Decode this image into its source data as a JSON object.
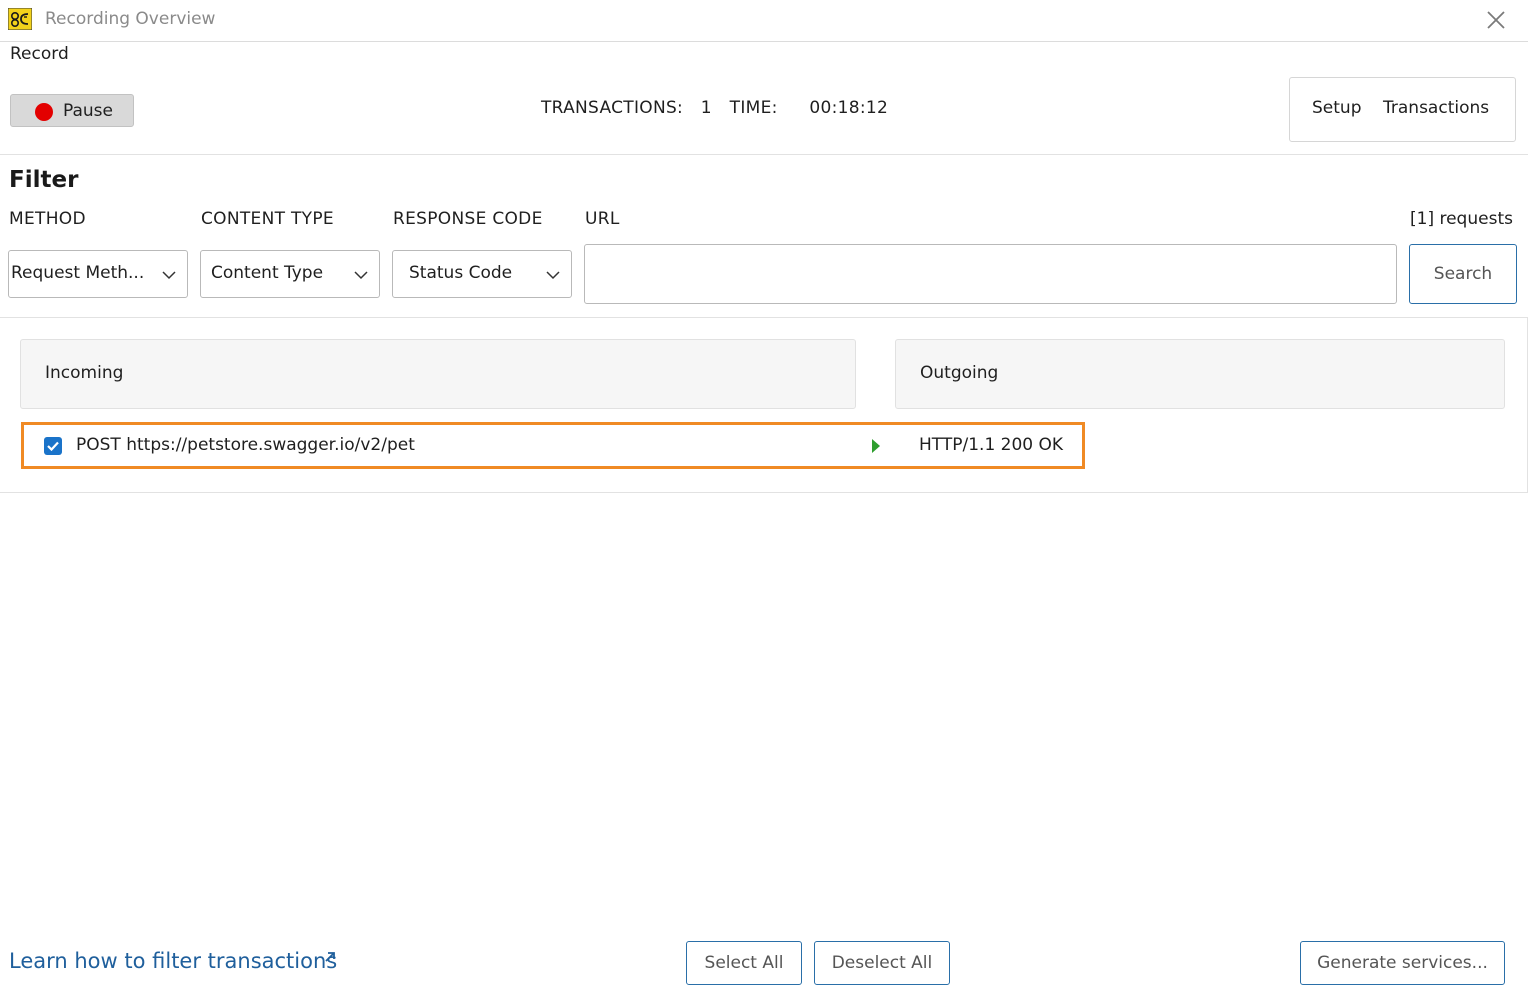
{
  "window": {
    "title": "Recording Overview",
    "app_icon": "app-logo-icon",
    "close_icon": "close-icon"
  },
  "record": {
    "section_label": "Record",
    "pause_label": "Pause",
    "transactions_label": "TRANSACTIONS:",
    "transactions_count": "1",
    "time_label": "TIME:",
    "time_value": "00:18:12",
    "view_tabs": [
      "Setup",
      "Transactions"
    ]
  },
  "filter": {
    "title": "Filter",
    "method_label": "METHOD",
    "content_type_label": "CONTENT TYPE",
    "response_code_label": "RESPONSE CODE",
    "url_label": "URL",
    "requests_count": "[1] requests",
    "method_value": "Request Meth...",
    "content_type_value": "Content Type",
    "status_code_value": "Status Code",
    "url_value": "",
    "search_label": "Search"
  },
  "transactions": {
    "incoming_header": "Incoming",
    "outgoing_header": "Outgoing",
    "rows": [
      {
        "checked": true,
        "request": "POST https://petstore.swagger.io/v2/pet",
        "response": "HTTP/1.1 200 OK"
      }
    ]
  },
  "footer": {
    "learn_link": "Learn how to filter transactions",
    "select_all": "Select All",
    "deselect_all": "Deselect All",
    "generate": "Generate services..."
  },
  "colors": {
    "accent_blue": "#2a6fa8",
    "link_blue": "#1f5f9c",
    "checkbox_blue": "#1a73c9",
    "record_red": "#e30000",
    "highlight_orange": "#f08a24",
    "arrow_green": "#2e9e2e"
  }
}
